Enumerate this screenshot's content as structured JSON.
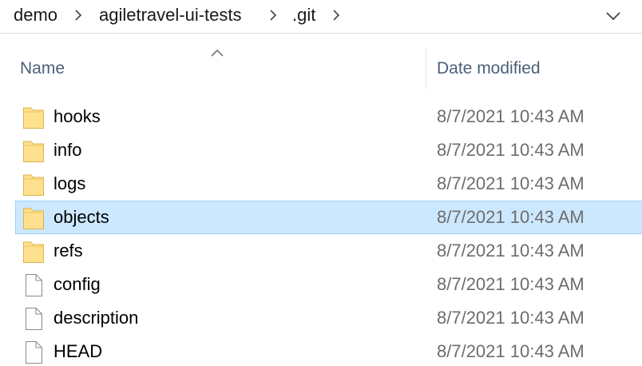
{
  "breadcrumb": {
    "items": [
      "demo",
      "agiletravel-ui-tests",
      ".git"
    ]
  },
  "columns": {
    "name": "Name",
    "date_modified": "Date modified",
    "sorted_by": "Name",
    "sort_direction": "ascending"
  },
  "files": [
    {
      "name": "hooks",
      "date": "8/7/2021 10:43 AM",
      "type": "folder",
      "selected": false
    },
    {
      "name": "info",
      "date": "8/7/2021 10:43 AM",
      "type": "folder",
      "selected": false
    },
    {
      "name": "logs",
      "date": "8/7/2021 10:43 AM",
      "type": "folder",
      "selected": false
    },
    {
      "name": "objects",
      "date": "8/7/2021 10:43 AM",
      "type": "folder",
      "selected": true
    },
    {
      "name": "refs",
      "date": "8/7/2021 10:43 AM",
      "type": "folder",
      "selected": false
    },
    {
      "name": "config",
      "date": "8/7/2021 10:43 AM",
      "type": "file",
      "selected": false
    },
    {
      "name": "description",
      "date": "8/7/2021 10:43 AM",
      "type": "file",
      "selected": false
    },
    {
      "name": "HEAD",
      "date": "8/7/2021 10:43 AM",
      "type": "file",
      "selected": false
    }
  ],
  "colors": {
    "selection_fill": "#cce8ff",
    "selection_border": "#99d1ff",
    "folder_fill": "#ffe08f",
    "header_text": "#4c607a"
  }
}
